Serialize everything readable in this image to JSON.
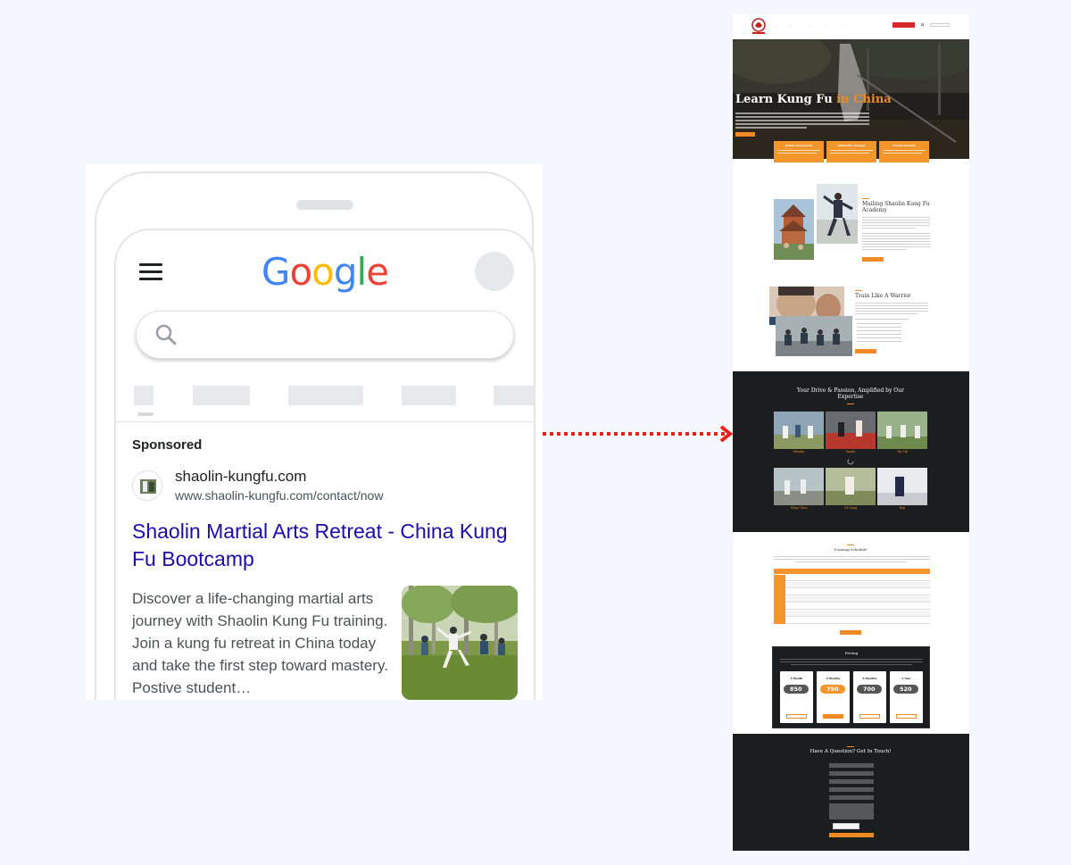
{
  "phone": {
    "logo_text": "Google",
    "sponsored_label": "Sponsored",
    "ad": {
      "domain": "shaolin-kungfu.com",
      "url": "www.shaolin-kungfu.com/contact/now",
      "title": "Shaolin Martial Arts Retreat - China Kung Fu Bootcamp",
      "description": "Discover a life-changing martial arts journey with Shaolin Kung Fu training. Join a kung fu retreat in China today and take the first step toward mastery. Postive student…"
    }
  },
  "site": {
    "hero_title_main": "Learn Kung Fu",
    "hero_title_accent": " in China",
    "features": [
      "Global Community",
      "Authentic Lineage",
      "Proven Results"
    ],
    "academy_title": "Mailing Shaolin Kung Fu Academy",
    "warrior_title": "Train Like A Warrior",
    "expertise_title": "Your Drive & Passion, Amplified by Our Expertise",
    "styles": [
      "Shaolin",
      "Sanda",
      "Tai Chi",
      "Wing Chun",
      "Qi Gong",
      "Baji"
    ],
    "schedule_title": "Training Schedule",
    "pricing_title": "Pricing",
    "plans": [
      {
        "name": "1 Month",
        "price": "850"
      },
      {
        "name": "3 Months",
        "price": "790"
      },
      {
        "name": "6 Months",
        "price": "700"
      },
      {
        "name": "1 Year",
        "price": "520"
      }
    ],
    "contact_title": "Have A Question? Get In Touch!"
  },
  "colors": {
    "google_blue": "#4285F4",
    "google_red": "#EA4335",
    "google_yellow": "#FBBC05",
    "google_green": "#34A853",
    "ad_title": "#1a0dab",
    "site_accent": "#f08a24",
    "site_dark": "#1b1d1e",
    "arrow_red": "#e8201c"
  }
}
